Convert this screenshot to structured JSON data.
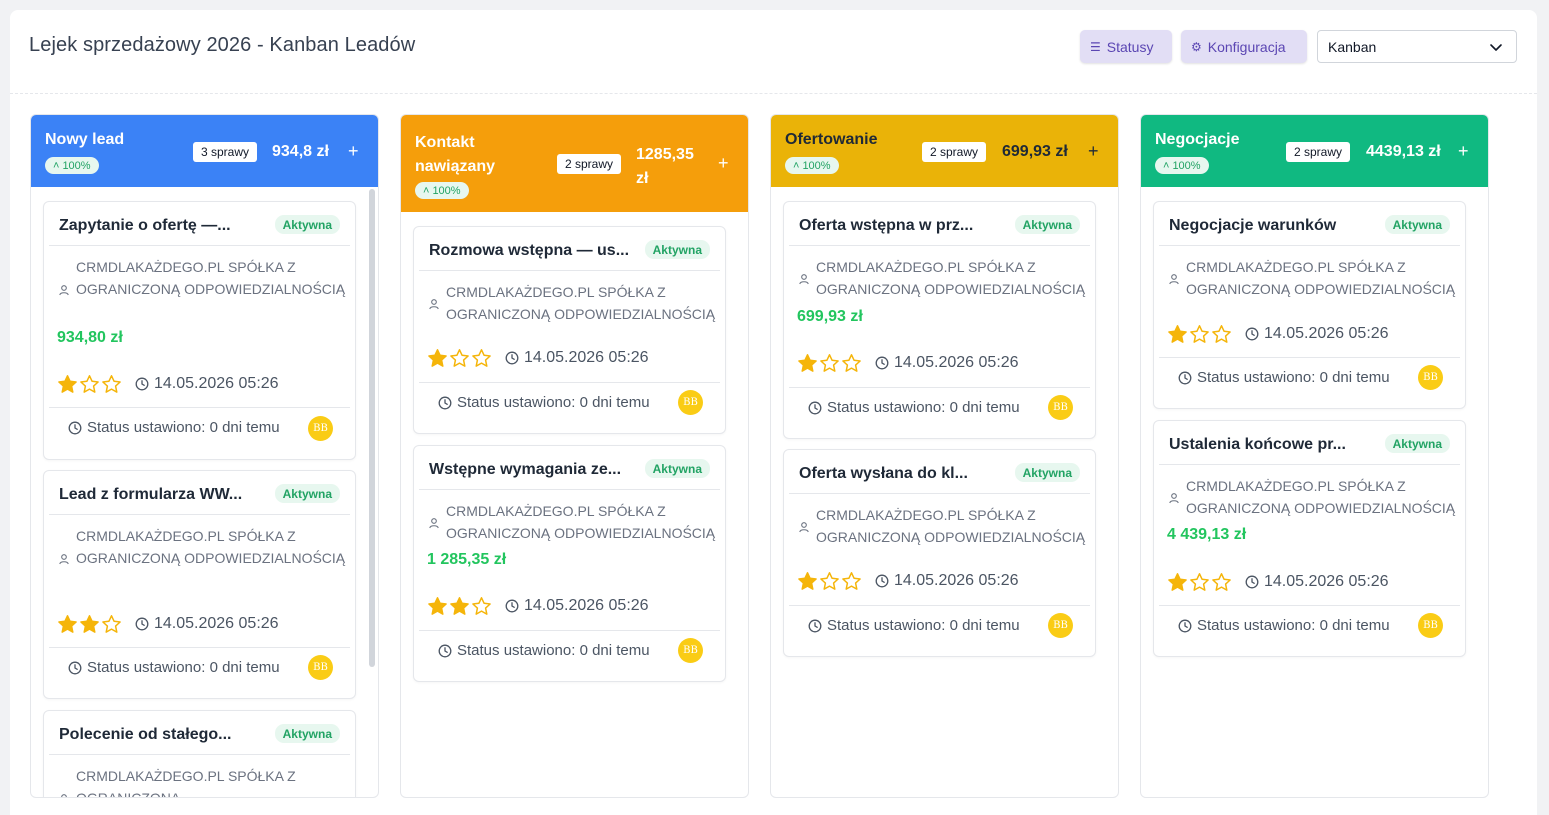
{
  "header": {
    "title": "Lejek sprzedażowy 2026 - Kanban Leadów",
    "statusy_label": "Statusy",
    "konfiguracja_label": "Konfiguracja",
    "view_select": "Kanban"
  },
  "colors": {
    "nowy": "#3b82f6",
    "kontakt": "#f59e0b",
    "ofertowanie": "#eab308",
    "negocjacje": "#10b981",
    "active_badge": "#22a364",
    "amount": "#22c55e",
    "star": "#f5b50a",
    "avatar": "#facc15"
  },
  "columns": [
    {
      "name": "Nowy lead",
      "count": "3 sprawy",
      "sum": "934,8 zł",
      "pct": "100%",
      "cards": [
        {
          "title": "Zapytanie o ofertę —...",
          "status": "Aktywna",
          "company": "CRMDLAKAŻDEGO.PL SPÓŁKA Z OGRANICZONĄ ODPOWIEDZIALNOŚCIĄ",
          "amount": "934,80 zł",
          "rating": 1,
          "date": "14.05.2026 05:26",
          "status_text": "Status ustawiono: 0 dni temu",
          "avatar": "BB"
        },
        {
          "title": "Lead z formularza WW...",
          "status": "Aktywna",
          "company": "CRMDLAKAŻDEGO.PL SPÓŁKA Z OGRANICZONĄ ODPOWIEDZIALNOŚCIĄ",
          "rating": 2,
          "date": "14.05.2026 05:26",
          "status_text": "Status ustawiono: 0 dni temu",
          "avatar": "BB"
        },
        {
          "title": "Polecenie od stałego...",
          "status": "Aktywna",
          "company": "CRMDLAKAŻDEGO.PL SPÓŁKA Z OGRANICZONA"
        }
      ]
    },
    {
      "name": "Kontakt nawiązany",
      "count": "2 sprawy",
      "sum": "1285,35 zł",
      "pct": "100%",
      "cards": [
        {
          "title": "Rozmowa wstępna — us...",
          "status": "Aktywna",
          "company": "CRMDLAKAŻDEGO.PL SPÓŁKA Z OGRANICZONĄ ODPOWIEDZIALNOŚCIĄ",
          "rating": 1,
          "date": "14.05.2026 05:26",
          "status_text": "Status ustawiono: 0 dni temu",
          "avatar": "BB"
        },
        {
          "title": "Wstępne wymagania ze...",
          "status": "Aktywna",
          "company": "CRMDLAKAŻDEGO.PL SPÓŁKA Z OGRANICZONĄ ODPOWIEDZIALNOŚCIĄ",
          "amount": "1 285,35 zł",
          "rating": 2,
          "date": "14.05.2026 05:26",
          "status_text": "Status ustawiono: 0 dni temu",
          "avatar": "BB"
        }
      ]
    },
    {
      "name": "Ofertowanie",
      "count": "2 sprawy",
      "sum": "699,93 zł",
      "pct": "100%",
      "cards": [
        {
          "title": "Oferta wstępna w prz...",
          "status": "Aktywna",
          "company": "CRMDLAKAŻDEGO.PL SPÓŁKA Z OGRANICZONĄ ODPOWIEDZIALNOŚCIĄ",
          "amount": "699,93 zł",
          "rating": 1,
          "date": "14.05.2026 05:26",
          "status_text": "Status ustawiono: 0 dni temu",
          "avatar": "BB"
        },
        {
          "title": "Oferta wysłana do kl...",
          "status": "Aktywna",
          "company": "CRMDLAKAŻDEGO.PL SPÓŁKA Z OGRANICZONĄ ODPOWIEDZIALNOŚCIĄ",
          "rating": 1,
          "date": "14.05.2026 05:26",
          "status_text": "Status ustawiono: 0 dni temu",
          "avatar": "BB"
        }
      ]
    },
    {
      "name": "Negocjacje",
      "count": "2 sprawy",
      "sum": "4439,13 zł",
      "pct": "100%",
      "cards": [
        {
          "title": "Negocjacje warunków",
          "status": "Aktywna",
          "company": "CRMDLAKAŻDEGO.PL SPÓŁKA Z OGRANICZONĄ ODPOWIEDZIALNOŚCIĄ",
          "rating": 1,
          "date": "14.05.2026 05:26",
          "status_text": "Status ustawiono: 0 dni temu",
          "avatar": "BB"
        },
        {
          "title": "Ustalenia końcowe pr...",
          "status": "Aktywna",
          "company": "CRMDLAKAŻDEGO.PL SPÓŁKA Z OGRANICZONĄ ODPOWIEDZIALNOŚCIĄ",
          "amount": "4 439,13 zł",
          "rating": 1,
          "date": "14.05.2026 05:26",
          "status_text": "Status ustawiono: 0 dni temu",
          "avatar": "BB"
        }
      ]
    }
  ]
}
